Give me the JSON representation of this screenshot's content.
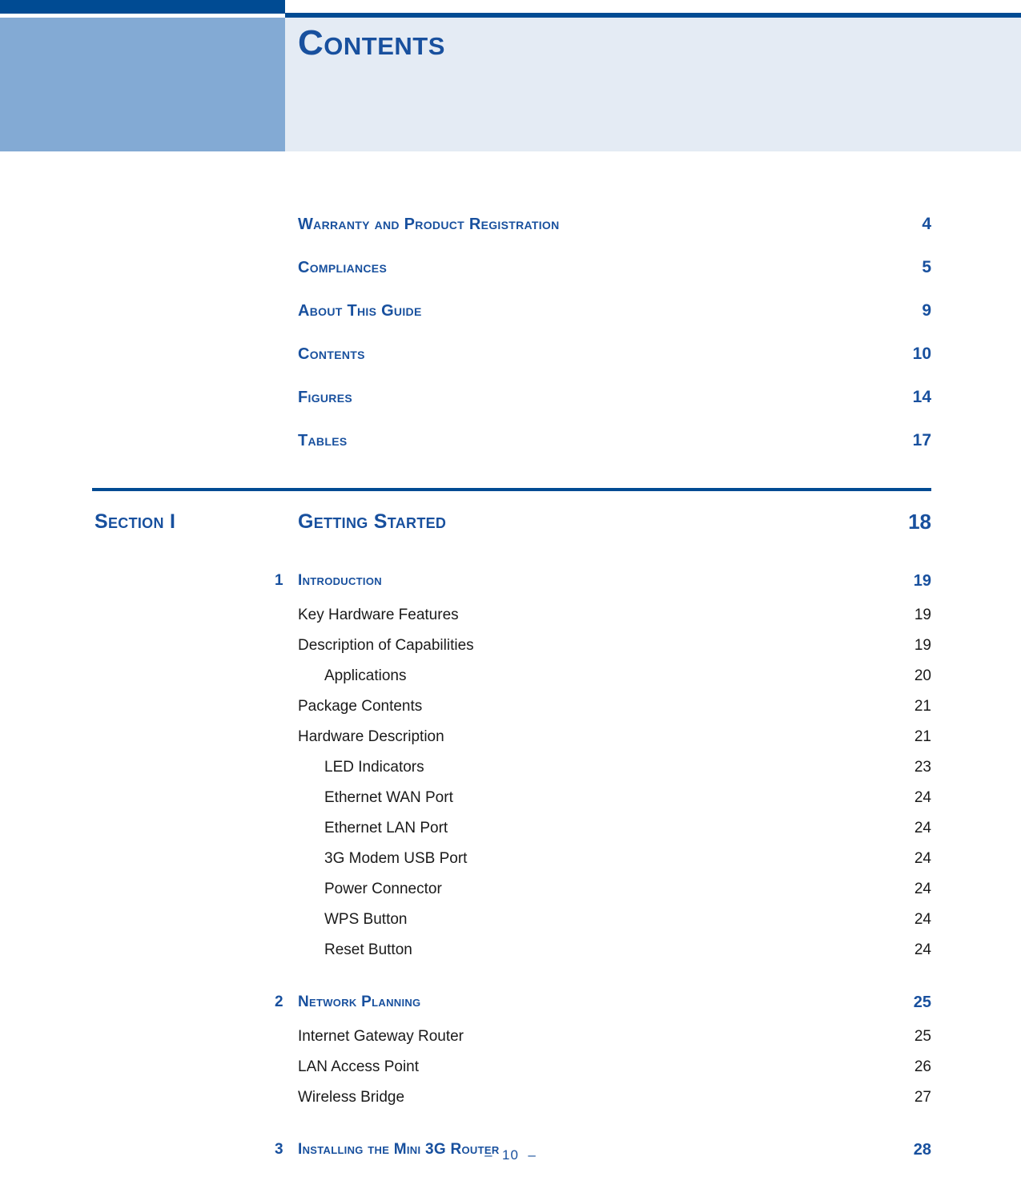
{
  "header": {
    "title": "Contents"
  },
  "front_matter": [
    {
      "label": "Warranty and Product Registration",
      "page": "4"
    },
    {
      "label": "Compliances",
      "page": "5"
    },
    {
      "label": "About This Guide",
      "page": "9"
    },
    {
      "label": "Contents",
      "page": "10"
    },
    {
      "label": "Figures",
      "page": "14"
    },
    {
      "label": "Tables",
      "page": "17"
    }
  ],
  "section": {
    "name": "Section I",
    "label": "Getting Started",
    "page": "18"
  },
  "entries": [
    {
      "level": "chapter",
      "num": "1",
      "label": "Introduction",
      "page": "19"
    },
    {
      "level": "lvl1",
      "label": "Key Hardware Features",
      "page": "19"
    },
    {
      "level": "lvl1",
      "label": "Description of Capabilities",
      "page": "19"
    },
    {
      "level": "lvl2",
      "label": "Applications",
      "page": "20"
    },
    {
      "level": "lvl1",
      "label": "Package Contents",
      "page": "21"
    },
    {
      "level": "lvl1",
      "label": "Hardware Description",
      "page": "21"
    },
    {
      "level": "lvl2",
      "label": "LED Indicators",
      "page": "23"
    },
    {
      "level": "lvl2",
      "label": "Ethernet WAN Port",
      "page": "24"
    },
    {
      "level": "lvl2",
      "label": "Ethernet LAN Port",
      "page": "24"
    },
    {
      "level": "lvl2",
      "label": "3G Modem USB Port",
      "page": "24"
    },
    {
      "level": "lvl2",
      "label": "Power Connector",
      "page": "24"
    },
    {
      "level": "lvl2",
      "label": "WPS Button",
      "page": "24"
    },
    {
      "level": "lvl2",
      "label": "Reset Button",
      "page": "24"
    },
    {
      "level": "chapter",
      "num": "2",
      "label": "Network Planning",
      "page": "25"
    },
    {
      "level": "lvl1",
      "label": "Internet Gateway Router",
      "page": "25"
    },
    {
      "level": "lvl1",
      "label": "LAN Access Point",
      "page": "26"
    },
    {
      "level": "lvl1",
      "label": "Wireless Bridge",
      "page": "27"
    },
    {
      "level": "chapter",
      "num": "3",
      "label": "Installing the Mini 3G Router",
      "page": "28"
    }
  ],
  "footer": {
    "folio": "–  10  –"
  },
  "colors": {
    "accent_dark": "#004b93",
    "accent_text": "#18509e",
    "band_light": "#83aad4",
    "panel": "#e4ebf4",
    "body_text": "#1a1a1a"
  }
}
